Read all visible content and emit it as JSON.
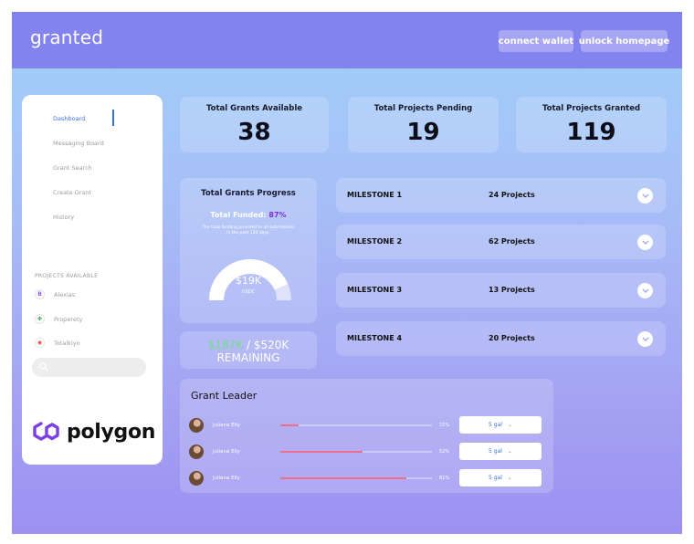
{
  "app": {
    "brand": "granted"
  },
  "header": {
    "connect_label": "connect wallet",
    "unlock_label": "unlock homepage"
  },
  "sidebar": {
    "nav": [
      {
        "label": "Dashboard",
        "active": true
      },
      {
        "label": "Messaging Board"
      },
      {
        "label": "Grant Search"
      },
      {
        "label": "Create Grant"
      },
      {
        "label": "History"
      }
    ],
    "projects_heading": "PROJECTS AVAILABLE",
    "projects": [
      {
        "label": "Alexias",
        "icon": "alexias-logo-icon",
        "color": "#8a5cf0",
        "glyph": "B"
      },
      {
        "label": "Properety",
        "icon": "properety-logo-icon",
        "color": "#2f9b4f",
        "glyph": "✤"
      },
      {
        "label": "Totalkiyo",
        "icon": "totalkiyo-logo-icon",
        "color": "#e0493a",
        "glyph": "◉"
      }
    ],
    "search_placeholder": "",
    "logo_text": "polygon"
  },
  "stats": [
    {
      "label": "Total Grants Available",
      "value": "38"
    },
    {
      "label": "Total Projects Pending",
      "value": "19"
    },
    {
      "label": "Total Projects Granted",
      "value": "119"
    }
  ],
  "progress": {
    "title": "Total Grants Progress",
    "funded_label": "Total Funded:",
    "funded_pct": "87%",
    "funded_fraction": 0.87,
    "description": "The total funding provided to all submissions in the past 120 days.",
    "gauge_value": "$19K",
    "gauge_unit": "USDC"
  },
  "remaining": {
    "amount_green": "$187K",
    "amount_rest": " / $520K",
    "label": "REMAINING"
  },
  "milestones": [
    {
      "name": "MILESTONE 1",
      "projects": "24 Projects"
    },
    {
      "name": "MILESTONE 2",
      "projects": "62 Projects"
    },
    {
      "name": "MILESTONE 3",
      "projects": "13 Projects"
    },
    {
      "name": "MILESTONE 4",
      "projects": "20 Projects"
    }
  ],
  "leader": {
    "title": "Grant Leader",
    "rows": [
      {
        "name": "Juliana Elly",
        "pct": "15%",
        "fraction": 0.12,
        "select": "5 gal"
      },
      {
        "name": "Juliana Elly",
        "pct": "52%",
        "fraction": 0.54,
        "select": "5 gal"
      },
      {
        "name": "Juliana Elly",
        "pct": "81%",
        "fraction": 0.83,
        "select": "5 gal"
      }
    ]
  },
  "colors": {
    "header_bg": "#8283ee",
    "accent_blue": "#3a6fe0",
    "funded_purple": "#7a2fd8",
    "remaining_green": "#6fe08c",
    "leader_bar": "#ee6d87"
  }
}
